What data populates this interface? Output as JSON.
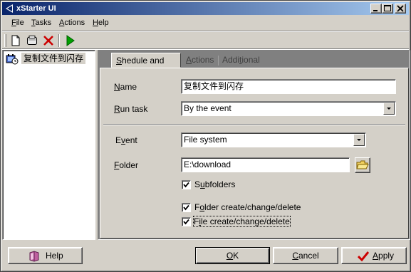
{
  "window": {
    "title": "xStarter UI",
    "controls": {
      "minimize": "_",
      "maximize": "□",
      "close": "×"
    }
  },
  "menu": {
    "file": {
      "label": "File",
      "accel": "F",
      "rest": "ile"
    },
    "tasks": {
      "label": "Tasks",
      "accel": "T",
      "rest": "asks"
    },
    "actions": {
      "label": "Actions",
      "accel": "A",
      "rest": "ctions"
    },
    "help": {
      "label": "Help",
      "accel": "H",
      "rest": "elp"
    }
  },
  "toolbar": {
    "icons": [
      "new-document-icon",
      "open-task-icon",
      "delete-icon",
      "run-icon"
    ]
  },
  "tree": {
    "items": [
      {
        "label": "复制文件到闪存",
        "icon": "task-scheduler-icon"
      }
    ]
  },
  "tabs": [
    {
      "label": "Shedule and info",
      "accel": "S",
      "rest": "hedule and info",
      "active": true
    },
    {
      "label": "Actions",
      "accel": "A",
      "rest": "ctions",
      "active": false
    },
    {
      "label": "Additional",
      "pre": "Addi",
      "accel": "t",
      "rest": "ional",
      "active": false
    }
  ],
  "form": {
    "name": {
      "label_accel": "N",
      "label_rest": "ame",
      "value": "复制文件到闪存"
    },
    "run_task": {
      "label_accel": "R",
      "label_rest": "un task",
      "value": "By the event"
    },
    "event": {
      "label_pre": "E",
      "label_accel": "v",
      "label_rest": "ent",
      "value": "File system"
    },
    "folder": {
      "label_accel": "F",
      "label_rest": "older",
      "value": "E:\\download",
      "browse_icon": "folder-open-icon"
    },
    "subfolders": {
      "label_pre": "S",
      "label_accel": "u",
      "label_rest": "bfolders",
      "checked": true
    },
    "folder_events": {
      "label_pre": "F",
      "label_accel": "o",
      "label_rest": "lder create/change/delete",
      "checked": true
    },
    "file_events": {
      "label_pre": "F",
      "label_accel": "i",
      "label_rest": "le create/change/delete",
      "checked": true
    }
  },
  "buttons": {
    "help": {
      "label": "Help",
      "icon": "help-book-icon"
    },
    "ok": {
      "label": "OK",
      "accel": "O",
      "rest": "K"
    },
    "cancel": {
      "label": "Cancel",
      "accel": "C",
      "rest": "ancel"
    },
    "apply": {
      "label": "Apply",
      "accel": "A",
      "rest": "pply",
      "icon": "checkmark-icon"
    }
  },
  "colors": {
    "title_gradient_start": "#0a246a",
    "title_gradient_end": "#a6caf0",
    "face": "#d4d0c8",
    "shadow": "#808080",
    "delete_red": "#cc0000",
    "run_green": "#00a000"
  }
}
